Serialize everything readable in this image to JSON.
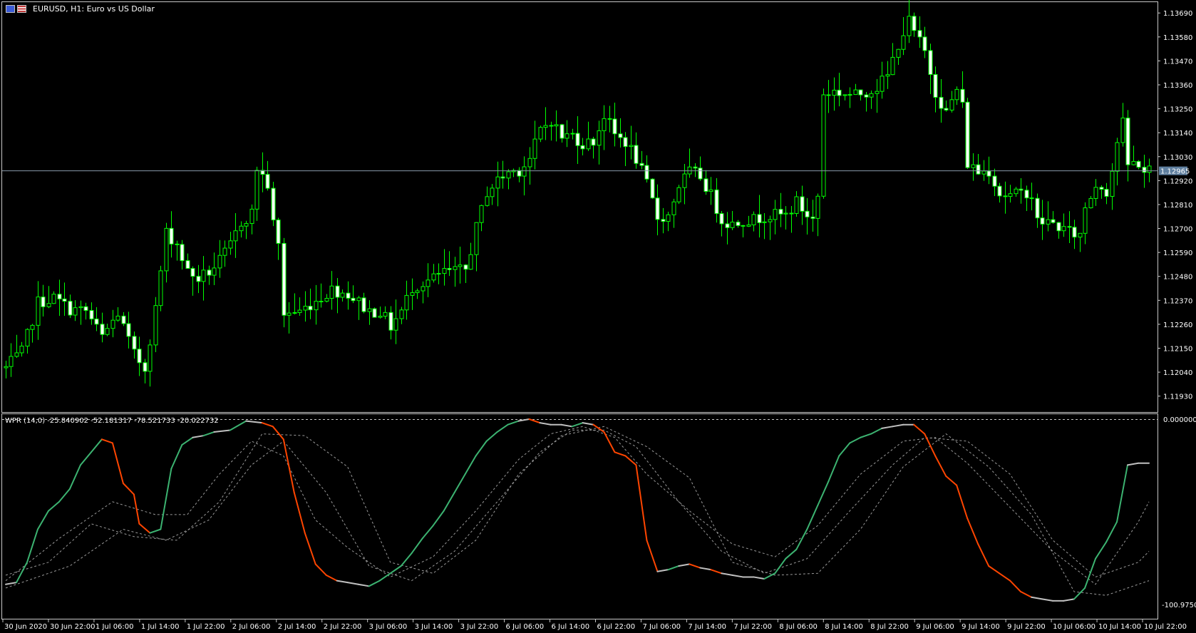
{
  "window": {
    "symbol_title": "EURUSD, H1:  Euro vs US Dollar"
  },
  "indicator": {
    "label": "WPR (14,0) -25.840902 -52.181317 -78.521733 -20.022732",
    "top_value": "0.000000",
    "bottom_value": "-100.975048"
  },
  "colors": {
    "background": "#000000",
    "candle": "#00ff00",
    "bull_body": "#000000",
    "bear_body": "#ffffff",
    "bid_line": "#8899aa",
    "price_tag_bg": "#5f7f9f",
    "wpr_up": "#3cb371",
    "wpr_down": "#ff4500",
    "wpr_flat": "#c0c0c0",
    "level_lines": "#9a9a9a"
  },
  "current_price": "1.12965",
  "chart_data": {
    "type": "candlestick",
    "symbol": "EURUSD",
    "timeframe": "H1",
    "price_axis_ticks": [
      "1.13690",
      "1.13580",
      "1.13470",
      "1.13360",
      "1.13250",
      "1.13140",
      "1.13030",
      "1.12920",
      "1.12810",
      "1.12700",
      "1.12590",
      "1.12480",
      "1.12370",
      "1.12260",
      "1.12150",
      "1.12040",
      "1.11930"
    ],
    "time_axis_ticks": [
      "30 Jun 2020",
      "30 Jun 22:00",
      "1 Jul 06:00",
      "1 Jul 14:00",
      "1 Jul 22:00",
      "2 Jul 06:00",
      "2 Jul 14:00",
      "2 Jul 22:00",
      "3 Jul 06:00",
      "3 Jul 14:00",
      "3 Jul 22:00",
      "6 Jul 06:00",
      "6 Jul 14:00",
      "6 Jul 22:00",
      "7 Jul 06:00",
      "7 Jul 14:00",
      "7 Jul 22:00",
      "8 Jul 06:00",
      "8 Jul 14:00",
      "8 Jul 22:00",
      "9 Jul 06:00",
      "9 Jul 14:00",
      "9 Jul 22:00",
      "10 Jul 06:00",
      "10 Jul 14:00",
      "10 Jul 22:00"
    ],
    "ylim": [
      1.1187,
      1.1373
    ],
    "close_path": [
      [
        0,
        1.1206
      ],
      [
        3,
        1.1213
      ],
      [
        6,
        1.1236
      ],
      [
        9,
        1.1238
      ],
      [
        12,
        1.1233
      ],
      [
        15,
        1.1232
      ],
      [
        18,
        1.122
      ],
      [
        21,
        1.1231
      ],
      [
        24,
        1.1212
      ],
      [
        26,
        1.1206
      ],
      [
        28,
        1.1233
      ],
      [
        30,
        1.1268
      ],
      [
        32,
        1.1263
      ],
      [
        34,
        1.125
      ],
      [
        36,
        1.1247
      ],
      [
        38,
        1.125
      ],
      [
        40,
        1.1255
      ],
      [
        42,
        1.1262
      ],
      [
        44,
        1.1273
      ],
      [
        46,
        1.1277
      ],
      [
        47,
        1.1298
      ],
      [
        49,
        1.129
      ],
      [
        50,
        1.1272
      ],
      [
        51,
        1.1262
      ],
      [
        52,
        1.1231
      ],
      [
        55,
        1.1232
      ],
      [
        58,
        1.1237
      ],
      [
        61,
        1.1242
      ],
      [
        64,
        1.124
      ],
      [
        66,
        1.1236
      ],
      [
        68,
        1.1232
      ],
      [
        70,
        1.1232
      ],
      [
        72,
        1.1225
      ],
      [
        74,
        1.1232
      ],
      [
        76,
        1.1243
      ],
      [
        78,
        1.1245
      ],
      [
        80,
        1.1247
      ],
      [
        82,
        1.125
      ],
      [
        84,
        1.125
      ],
      [
        86,
        1.1251
      ],
      [
        88,
        1.127
      ],
      [
        90,
        1.1287
      ],
      [
        92,
        1.1292
      ],
      [
        94,
        1.1296
      ],
      [
        96,
        1.1297
      ],
      [
        98,
        1.1302
      ],
      [
        100,
        1.1315
      ],
      [
        102,
        1.132
      ],
      [
        104,
        1.1312
      ],
      [
        106,
        1.1313
      ],
      [
        108,
        1.1309
      ],
      [
        110,
        1.131
      ],
      [
        112,
        1.1322
      ],
      [
        114,
        1.1313
      ],
      [
        116,
        1.131
      ],
      [
        118,
        1.1302
      ],
      [
        120,
        1.129
      ],
      [
        122,
        1.1275
      ],
      [
        124,
        1.1276
      ],
      [
        126,
        1.129
      ],
      [
        128,
        1.1296
      ],
      [
        130,
        1.1294
      ],
      [
        132,
        1.1285
      ],
      [
        134,
        1.1274
      ],
      [
        136,
        1.1272
      ],
      [
        138,
        1.1274
      ],
      [
        140,
        1.1274
      ],
      [
        142,
        1.1276
      ],
      [
        144,
        1.1276
      ],
      [
        146,
        1.1276
      ],
      [
        148,
        1.1282
      ],
      [
        150,
        1.1276
      ],
      [
        151,
        1.1274
      ],
      [
        152,
        1.1285
      ],
      [
        153,
        1.1332
      ],
      [
        155,
        1.1333
      ],
      [
        157,
        1.1332
      ],
      [
        159,
        1.1331
      ],
      [
        161,
        1.1333
      ],
      [
        163,
        1.1335
      ],
      [
        165,
        1.134
      ],
      [
        167,
        1.1355
      ],
      [
        169,
        1.1365
      ],
      [
        170,
        1.136
      ],
      [
        172,
        1.1351
      ],
      [
        174,
        1.1333
      ],
      [
        176,
        1.1323
      ],
      [
        178,
        1.1334
      ],
      [
        179,
        1.1326
      ],
      [
        180,
        1.13
      ],
      [
        182,
        1.1296
      ],
      [
        184,
        1.1297
      ],
      [
        186,
        1.1286
      ],
      [
        188,
        1.1285
      ],
      [
        190,
        1.1286
      ],
      [
        191,
        1.1287
      ],
      [
        192,
        1.1285
      ],
      [
        193,
        1.1273
      ],
      [
        195,
        1.1273
      ],
      [
        197,
        1.1271
      ],
      [
        199,
        1.1268
      ],
      [
        201,
        1.1267
      ],
      [
        202,
        1.128
      ],
      [
        204,
        1.129
      ],
      [
        205,
        1.129
      ],
      [
        206,
        1.1287
      ],
      [
        207,
        1.1297
      ],
      [
        208,
        1.131
      ],
      [
        209,
        1.1318
      ],
      [
        210,
        1.1299
      ],
      [
        211,
        1.13
      ],
      [
        212,
        1.13
      ],
      [
        213,
        1.1296
      ],
      [
        214,
        1.1297
      ]
    ],
    "wpr": {
      "ylim": [
        -100.975048,
        0
      ],
      "levels": [
        -25.840902,
        -52.181317,
        -78.521733,
        -20.022732
      ],
      "main_path": [
        [
          0,
          -90
        ],
        [
          2,
          -89
        ],
        [
          4,
          -78
        ],
        [
          6,
          -60
        ],
        [
          8,
          -50
        ],
        [
          10,
          -45
        ],
        [
          12,
          -38
        ],
        [
          14,
          -25
        ],
        [
          16,
          -18
        ],
        [
          18,
          -11
        ],
        [
          20,
          -13
        ],
        [
          22,
          -35
        ],
        [
          24,
          -41
        ],
        [
          25,
          -57
        ],
        [
          27,
          -62
        ],
        [
          29,
          -60
        ],
        [
          31,
          -27
        ],
        [
          33,
          -14
        ],
        [
          35,
          -10
        ],
        [
          37,
          -9
        ],
        [
          39,
          -7
        ],
        [
          42,
          -6
        ],
        [
          45,
          -1
        ],
        [
          48,
          -2
        ],
        [
          50,
          -4
        ],
        [
          52,
          -11
        ],
        [
          54,
          -40
        ],
        [
          56,
          -62
        ],
        [
          58,
          -79
        ],
        [
          60,
          -85
        ],
        [
          62,
          -88
        ],
        [
          64,
          -89
        ],
        [
          66,
          -90
        ],
        [
          68,
          -91
        ],
        [
          70,
          -88
        ],
        [
          72,
          -84
        ],
        [
          74,
          -80
        ],
        [
          76,
          -73
        ],
        [
          78,
          -65
        ],
        [
          80,
          -58
        ],
        [
          82,
          -50
        ],
        [
          84,
          -40
        ],
        [
          86,
          -30
        ],
        [
          88,
          -20
        ],
        [
          90,
          -12
        ],
        [
          92,
          -7
        ],
        [
          94,
          -3
        ],
        [
          96,
          -1
        ],
        [
          98,
          0
        ],
        [
          100,
          -2
        ],
        [
          102,
          -3
        ],
        [
          104,
          -3
        ],
        [
          106,
          -4
        ],
        [
          108,
          -2
        ],
        [
          110,
          -3
        ],
        [
          112,
          -7
        ],
        [
          114,
          -18
        ],
        [
          116,
          -20
        ],
        [
          118,
          -25
        ],
        [
          120,
          -66
        ],
        [
          122,
          -83
        ],
        [
          124,
          -82
        ],
        [
          126,
          -80
        ],
        [
          128,
          -79
        ],
        [
          130,
          -81
        ],
        [
          132,
          -82
        ],
        [
          134,
          -84
        ],
        [
          136,
          -85
        ],
        [
          138,
          -86
        ],
        [
          140,
          -86
        ],
        [
          142,
          -87
        ],
        [
          144,
          -84
        ],
        [
          146,
          -76
        ],
        [
          148,
          -71
        ],
        [
          150,
          -60
        ],
        [
          152,
          -47
        ],
        [
          154,
          -34
        ],
        [
          156,
          -20
        ],
        [
          158,
          -13
        ],
        [
          160,
          -10
        ],
        [
          162,
          -8
        ],
        [
          164,
          -5
        ],
        [
          166,
          -4
        ],
        [
          168,
          -3
        ],
        [
          170,
          -3
        ],
        [
          172,
          -8
        ],
        [
          174,
          -20
        ],
        [
          176,
          -31
        ],
        [
          178,
          -36
        ],
        [
          180,
          -54
        ],
        [
          182,
          -68
        ],
        [
          184,
          -80
        ],
        [
          186,
          -84
        ],
        [
          188,
          -88
        ],
        [
          190,
          -94
        ],
        [
          192,
          -97
        ],
        [
          194,
          -98
        ],
        [
          196,
          -99
        ],
        [
          198,
          -99
        ],
        [
          200,
          -98
        ],
        [
          202,
          -92
        ],
        [
          204,
          -76
        ],
        [
          206,
          -67
        ],
        [
          208,
          -56
        ],
        [
          210,
          -25
        ],
        [
          212,
          -24
        ],
        [
          214,
          -24
        ]
      ],
      "signal_paths": [
        [
          [
            0,
            -88
          ],
          [
            10,
            -65
          ],
          [
            20,
            -45
          ],
          [
            28,
            -52
          ],
          [
            34,
            -52
          ],
          [
            40,
            -30
          ],
          [
            46,
            -12
          ],
          [
            52,
            -20
          ],
          [
            58,
            -55
          ],
          [
            64,
            -70
          ],
          [
            72,
            -86
          ],
          [
            80,
            -75
          ],
          [
            88,
            -50
          ],
          [
            96,
            -22
          ],
          [
            102,
            -8
          ],
          [
            108,
            -4
          ],
          [
            114,
            -10
          ],
          [
            120,
            -30
          ],
          [
            128,
            -50
          ],
          [
            136,
            -68
          ],
          [
            144,
            -75
          ],
          [
            152,
            -58
          ],
          [
            160,
            -30
          ],
          [
            168,
            -12
          ],
          [
            174,
            -10
          ],
          [
            180,
            -24
          ],
          [
            188,
            -48
          ],
          [
            196,
            -72
          ],
          [
            204,
            -90
          ],
          [
            212,
            -56
          ],
          [
            214,
            -45
          ]
        ],
        [
          [
            0,
            -92
          ],
          [
            12,
            -80
          ],
          [
            22,
            -60
          ],
          [
            30,
            -66
          ],
          [
            38,
            -55
          ],
          [
            46,
            -25
          ],
          [
            52,
            -12
          ],
          [
            60,
            -40
          ],
          [
            68,
            -80
          ],
          [
            76,
            -88
          ],
          [
            84,
            -72
          ],
          [
            92,
            -45
          ],
          [
            100,
            -18
          ],
          [
            106,
            -6
          ],
          [
            112,
            -6
          ],
          [
            118,
            -15
          ],
          [
            126,
            -45
          ],
          [
            134,
            -72
          ],
          [
            142,
            -84
          ],
          [
            150,
            -76
          ],
          [
            158,
            -50
          ],
          [
            166,
            -25
          ],
          [
            172,
            -10
          ],
          [
            180,
            -12
          ],
          [
            188,
            -30
          ],
          [
            196,
            -66
          ],
          [
            204,
            -86
          ],
          [
            212,
            -78
          ],
          [
            214,
            -72
          ]
        ],
        [
          [
            0,
            -85
          ],
          [
            8,
            -78
          ],
          [
            16,
            -57
          ],
          [
            24,
            -64
          ],
          [
            32,
            -66
          ],
          [
            40,
            -45
          ],
          [
            48,
            -8
          ],
          [
            56,
            -9
          ],
          [
            64,
            -26
          ],
          [
            72,
            -78
          ],
          [
            80,
            -84
          ],
          [
            88,
            -66
          ],
          [
            96,
            -30
          ],
          [
            104,
            -9
          ],
          [
            112,
            -4
          ],
          [
            120,
            -15
          ],
          [
            128,
            -32
          ],
          [
            136,
            -78
          ],
          [
            144,
            -85
          ],
          [
            152,
            -84
          ],
          [
            160,
            -60
          ],
          [
            168,
            -26
          ],
          [
            176,
            -8
          ],
          [
            184,
            -26
          ],
          [
            192,
            -52
          ],
          [
            200,
            -94
          ],
          [
            206,
            -96
          ],
          [
            214,
            -88
          ]
        ]
      ]
    }
  }
}
